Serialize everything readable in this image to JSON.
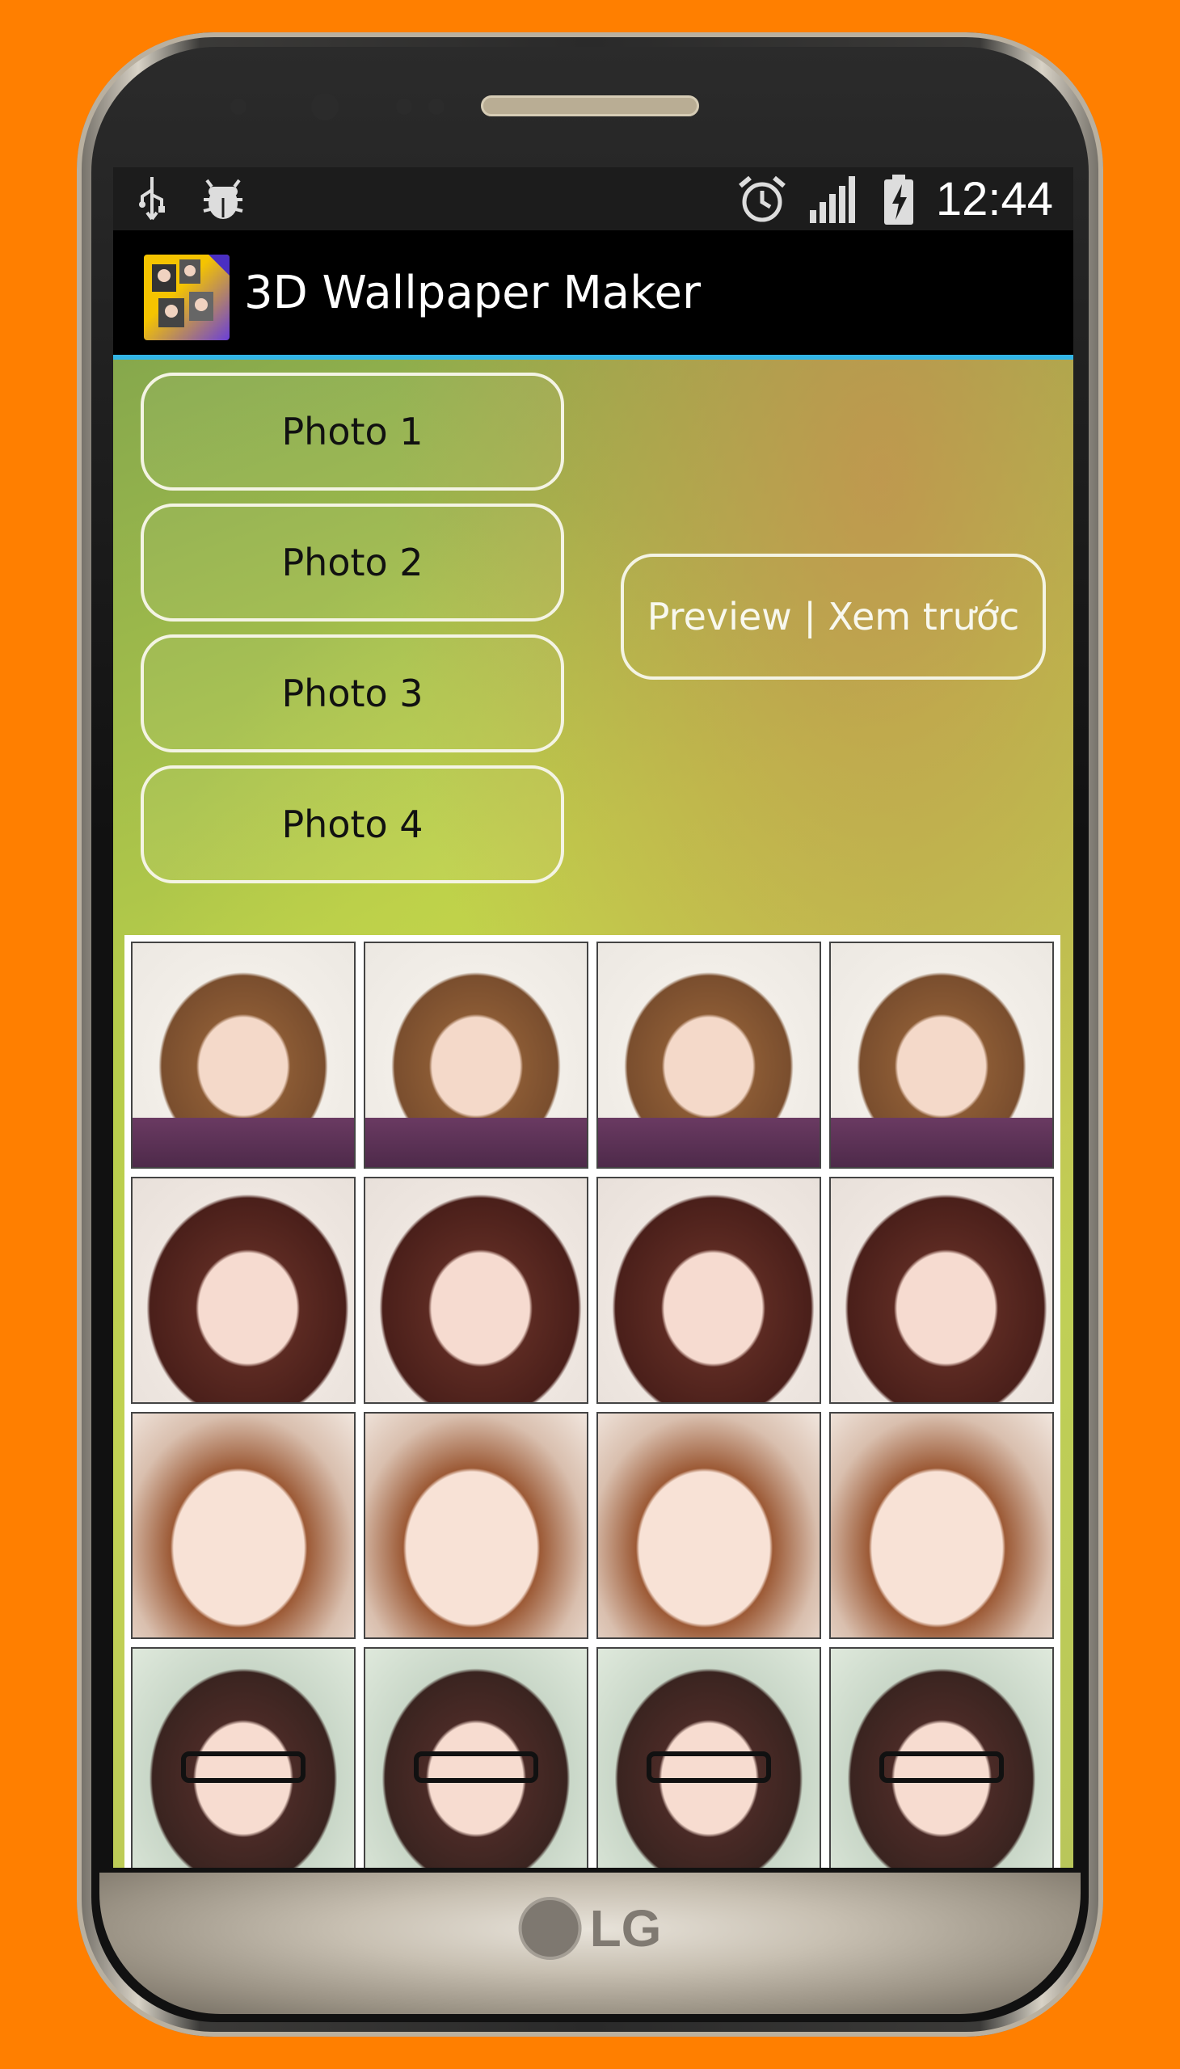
{
  "status_bar": {
    "left_icons": [
      "usb-icon",
      "debug-bug-icon"
    ],
    "right_icons": [
      "alarm-clock-icon",
      "signal-icon",
      "battery-charging-icon"
    ],
    "time": "12:44"
  },
  "action_bar": {
    "app_icon": "app-icon",
    "title": "3D Wallpaper Maker",
    "accent_color": "#33b5e5"
  },
  "buttons": {
    "photo1": "Photo 1",
    "photo2": "Photo 2",
    "photo3": "Photo 3",
    "photo4": "Photo 4",
    "preview": "Preview | Xem trước"
  },
  "device": {
    "brand": "LG"
  }
}
